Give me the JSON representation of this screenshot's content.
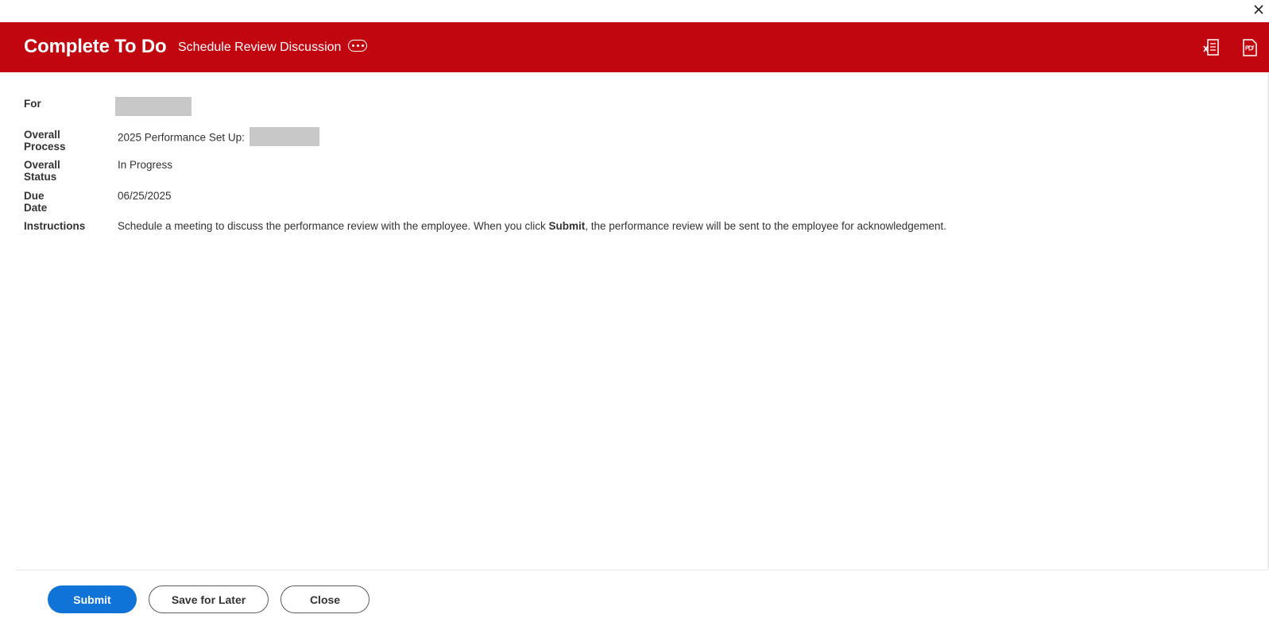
{
  "window": {
    "close_icon": "close-icon"
  },
  "header": {
    "background": "#c20610",
    "title": "Complete To Do",
    "subtitle": "Schedule Review Discussion",
    "more_icon": "more-ellipsis-icon",
    "export_excel_icon": "excel-export-icon",
    "export_pdf_icon": "pdf-export-icon"
  },
  "details": {
    "for": {
      "label": "For",
      "value_redacted": true
    },
    "overall_process": {
      "label": "Overall Process",
      "value_prefix": "2025 Performance Set Up: ",
      "value_redacted": true
    },
    "overall_status": {
      "label": "Overall Status",
      "value": "In Progress"
    },
    "due_date": {
      "label": "Due Date",
      "value": "06/25/2025"
    },
    "instructions": {
      "label": "Instructions",
      "text_before": "Schedule a meeting to discuss the performance review with the employee. When you click ",
      "text_bold": "Submit",
      "text_after": ", the performance review will be sent to the employee for acknowledgement."
    }
  },
  "footer": {
    "submit_label": "Submit",
    "save_for_later_label": "Save for Later",
    "close_label": "Close",
    "primary_color": "#0f73d8"
  }
}
